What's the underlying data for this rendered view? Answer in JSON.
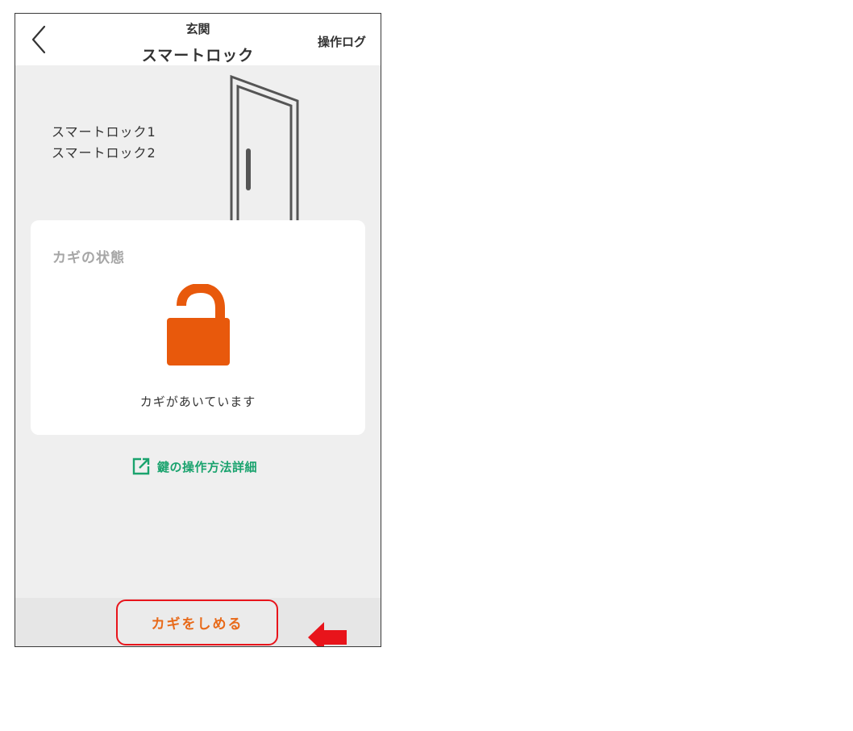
{
  "header": {
    "subtitle": "玄関",
    "title": "スマートロック",
    "log_label": "操作ログ"
  },
  "devices": [
    "スマートロック1",
    "スマートロック2"
  ],
  "lock_card": {
    "title": "カギの状態",
    "status": "カギがあいています",
    "state": "unlocked"
  },
  "help_link": {
    "label": "鍵の操作方法詳細",
    "icon": "external-link-icon"
  },
  "action_button": {
    "label": "カギをしめる"
  },
  "colors": {
    "accent_orange": "#e8590c",
    "link_green": "#1aa36e",
    "highlight_red": "#e8141b",
    "background_gray": "#efefef"
  }
}
